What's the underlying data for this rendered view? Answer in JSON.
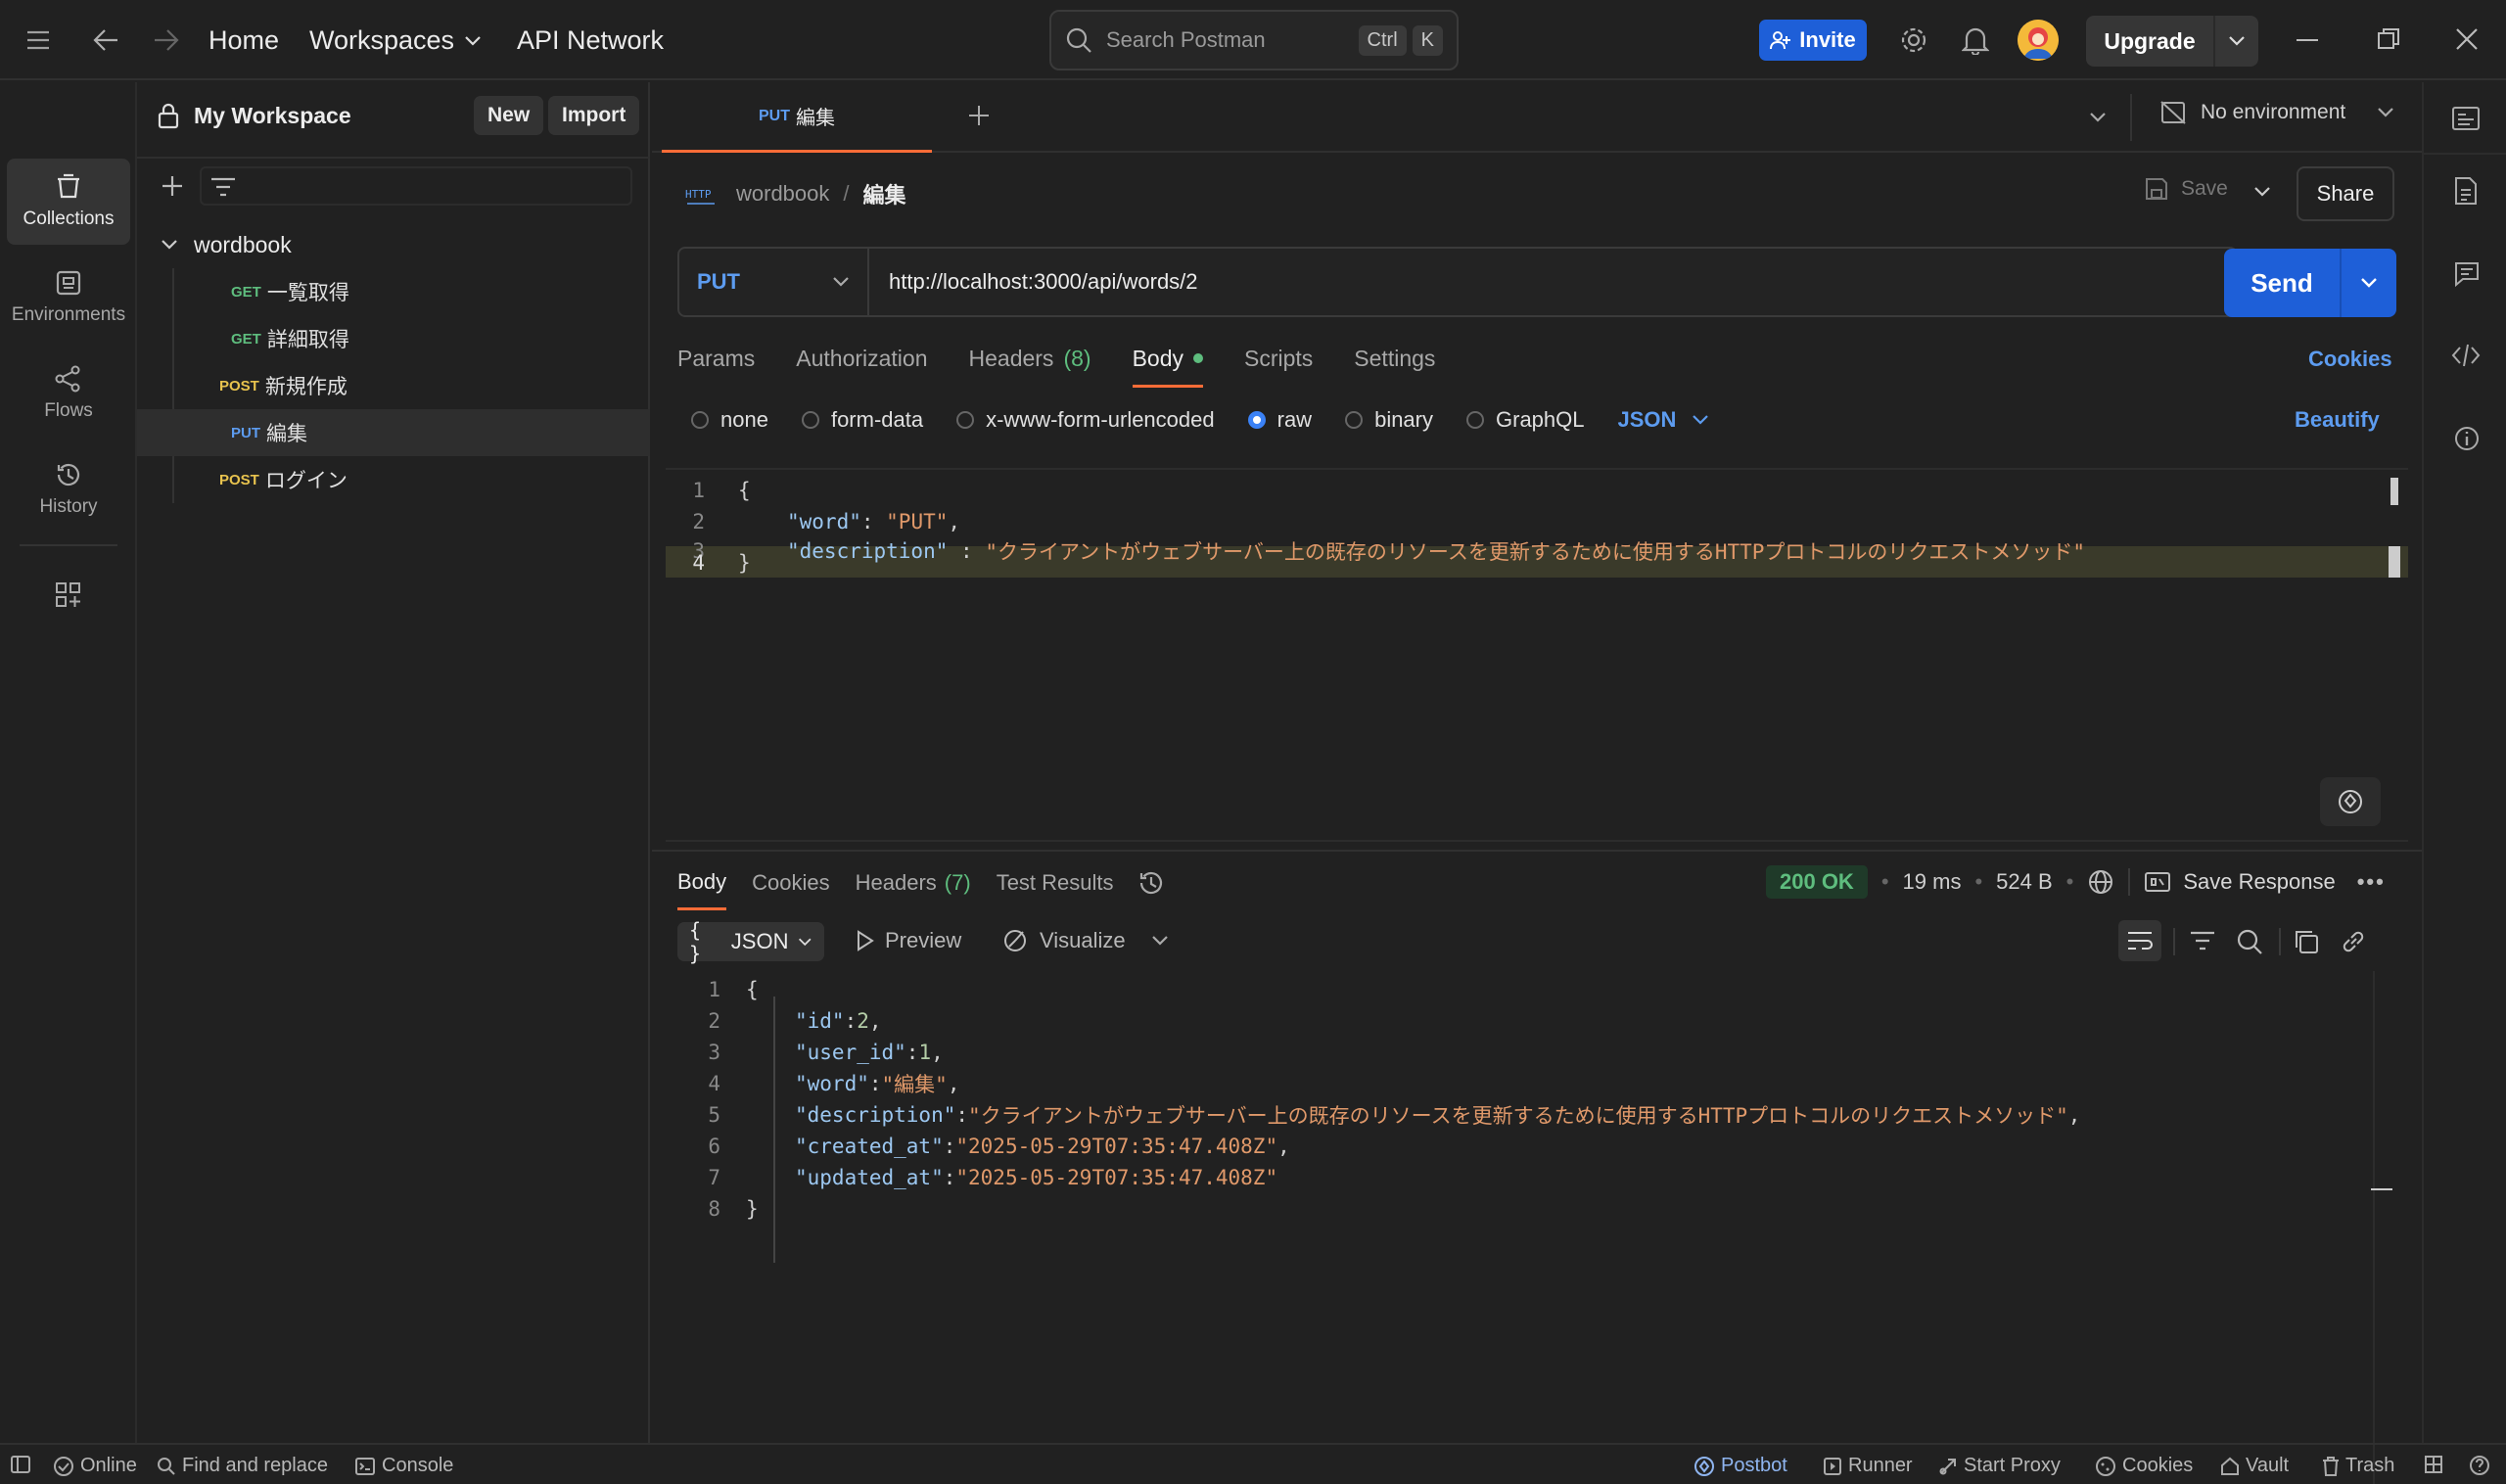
{
  "topbar": {
    "nav_home": "Home",
    "nav_workspaces": "Workspaces",
    "nav_api_network": "API Network",
    "search_placeholder": "Search Postman",
    "search_kbd_ctrl": "Ctrl",
    "search_kbd_k": "K",
    "invite_label": "Invite",
    "upgrade_label": "Upgrade"
  },
  "rail": {
    "items": [
      {
        "label": "Collections",
        "icon": "collections-icon"
      },
      {
        "label": "Environments",
        "icon": "environments-icon"
      },
      {
        "label": "Flows",
        "icon": "flows-icon"
      },
      {
        "label": "History",
        "icon": "history-icon"
      }
    ]
  },
  "sidebar": {
    "workspace_title": "My Workspace",
    "new_label": "New",
    "import_label": "Import",
    "collection_name": "wordbook",
    "requests": [
      {
        "method": "GET",
        "name": "一覧取得"
      },
      {
        "method": "GET",
        "name": "詳細取得"
      },
      {
        "method": "POST",
        "name": "新規作成"
      },
      {
        "method": "PUT",
        "name": "編集"
      },
      {
        "method": "POST",
        "name": "ログイン"
      }
    ]
  },
  "request_tab": {
    "method": "PUT",
    "name": "編集"
  },
  "environment": {
    "label": "No environment"
  },
  "breadcrumb": {
    "collection": "wordbook",
    "separator": "/",
    "request": "編集"
  },
  "actions": {
    "save_label": "Save",
    "share_label": "Share",
    "send_label": "Send"
  },
  "url_bar": {
    "method": "PUT",
    "url": "http://localhost:3000/api/words/2"
  },
  "request_tabs": {
    "params": "Params",
    "authorization": "Authorization",
    "headers": "Headers",
    "headers_count": "(8)",
    "body": "Body",
    "scripts": "Scripts",
    "settings": "Settings",
    "cookies": "Cookies"
  },
  "body_types": {
    "none": "none",
    "form_data": "form-data",
    "urlencoded": "x-www-form-urlencoded",
    "raw": "raw",
    "binary": "binary",
    "graphql": "GraphQL",
    "format": "JSON",
    "beautify": "Beautify",
    "selected": "raw"
  },
  "request_body": {
    "lines": [
      {
        "n": "1",
        "open": "{"
      },
      {
        "n": "2",
        "key": "\"word\"",
        "sep": ": ",
        "value": "\"PUT\"",
        "tail": ","
      },
      {
        "n": "3",
        "key": "\"description\"",
        "sep": " : ",
        "value": "\"クライアントがウェブサーバー上の既存のリソースを更新するために使用するHTTPプロトコルのリクエストメソッド\"",
        "tail": ""
      },
      {
        "n": "4",
        "close": "}"
      }
    ]
  },
  "response": {
    "tabs": {
      "body": "Body",
      "cookies": "Cookies",
      "headers": "Headers",
      "headers_count": "(7)",
      "test_results": "Test Results"
    },
    "status": "200 OK",
    "time": "19 ms",
    "size": "524 B",
    "save_response": "Save Response",
    "format": "JSON",
    "preview": "Preview",
    "visualize": "Visualize",
    "lines": [
      {
        "n": "1",
        "text": "{"
      },
      {
        "n": "2",
        "key": "\"id\"",
        "value": "2",
        "type": "n",
        "tail": ","
      },
      {
        "n": "3",
        "key": "\"user_id\"",
        "value": "1",
        "type": "n",
        "tail": ","
      },
      {
        "n": "4",
        "key": "\"word\"",
        "value": "\"編集\"",
        "type": "s",
        "tail": ","
      },
      {
        "n": "5",
        "key": "\"description\"",
        "value": "\"クライアントがウェブサーバー上の既存のリソースを更新するために使用するHTTPプロトコルのリクエストメソッド\"",
        "type": "s",
        "tail": ","
      },
      {
        "n": "6",
        "key": "\"created_at\"",
        "value": "\"2025-05-29T07:35:47.408Z\"",
        "type": "s",
        "tail": ","
      },
      {
        "n": "7",
        "key": "\"updated_at\"",
        "value": "\"2025-05-29T07:35:47.408Z\"",
        "type": "s",
        "tail": ""
      },
      {
        "n": "8",
        "text": "}"
      }
    ]
  },
  "footer": {
    "online": "Online",
    "find_replace": "Find and replace",
    "console": "Console",
    "postbot": "Postbot",
    "runner": "Runner",
    "start_proxy": "Start Proxy",
    "cookies": "Cookies",
    "vault": "Vault",
    "trash": "Trash"
  },
  "colors": {
    "accent_orange": "#ff6c37",
    "send_blue": "#1e5fd8",
    "status_green": "#5ebd7e"
  }
}
